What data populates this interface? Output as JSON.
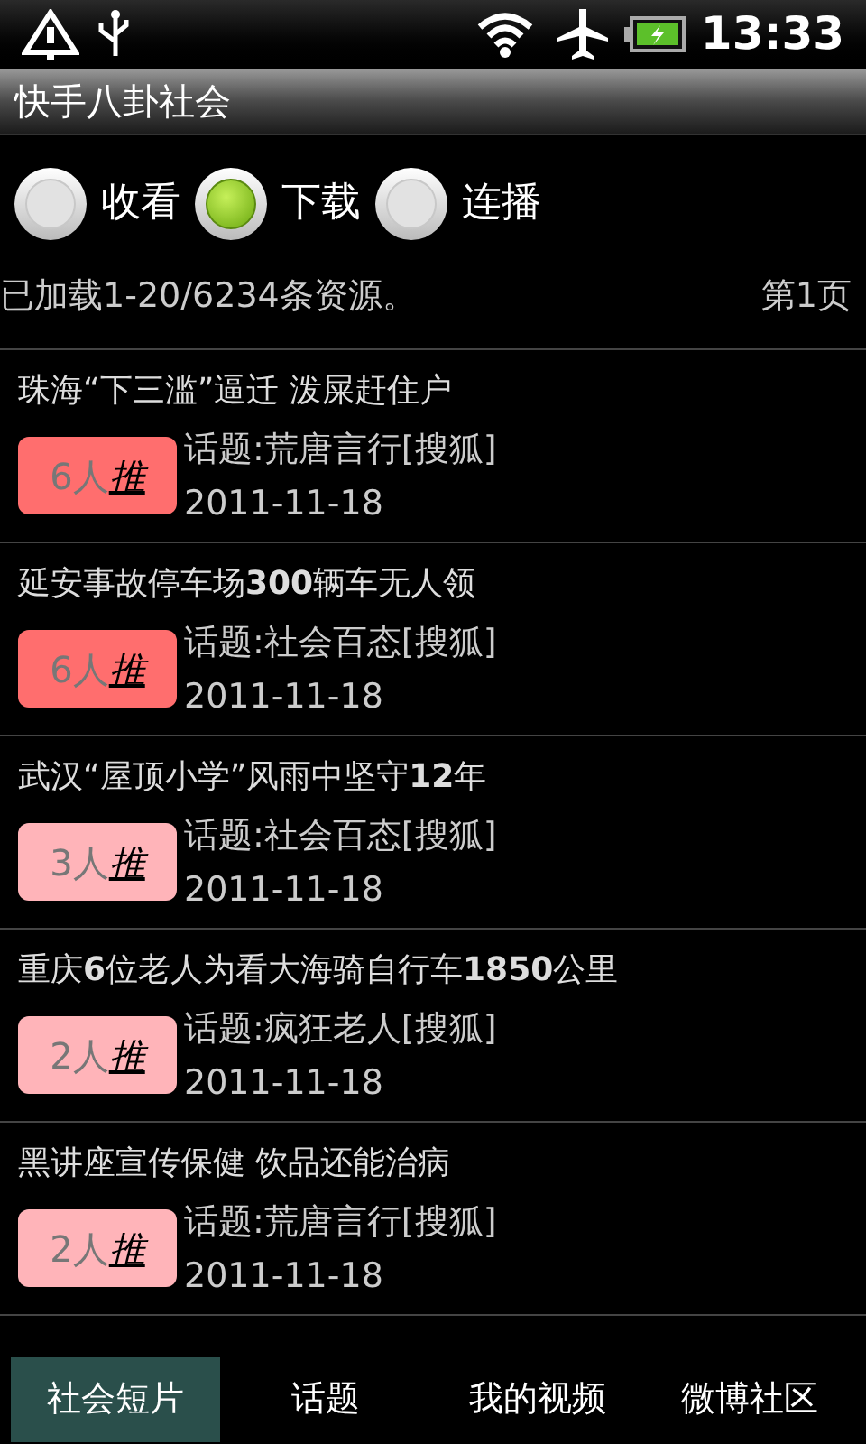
{
  "status_bar": {
    "time": "13:33"
  },
  "window": {
    "title": "快手八卦社会"
  },
  "modes": [
    {
      "label": "收看",
      "selected": false
    },
    {
      "label": "下载",
      "selected": true
    },
    {
      "label": "连播",
      "selected": false
    }
  ],
  "info": {
    "loaded": "已加载1-20/6234条资源。",
    "page": "第1页"
  },
  "items": [
    {
      "title": "珠海“下三滥”逼迁 泼屎赶住户",
      "count": "6人",
      "recommend": "推",
      "color": "#ff6e6e",
      "topic": "话题:荒唐言行[搜狐]",
      "date": "2011-11-18"
    },
    {
      "title": "延安事故停车场**300**辆车无人领",
      "count": "6人",
      "recommend": "推",
      "color": "#ff6e6e",
      "topic": "话题:社会百态[搜狐]",
      "date": "2011-11-18"
    },
    {
      "title": "武汉“屋顶小学”风雨中坚守**12**年",
      "count": "3人",
      "recommend": "推",
      "color": "#ffb4b9",
      "topic": "话题:社会百态[搜狐]",
      "date": "2011-11-18"
    },
    {
      "title": "重庆**6**位老人为看大海骑自行车**1850**公里",
      "count": "2人",
      "recommend": "推",
      "color": "#ffb4b9",
      "topic": "话题:疯狂老人[搜狐]",
      "date": "2011-11-18"
    },
    {
      "title": "黑讲座宣传保健 饮品还能治病",
      "count": "2人",
      "recommend": "推",
      "color": "#ffb4b9",
      "topic": "话题:荒唐言行[搜狐]",
      "date": "2011-11-18"
    }
  ],
  "tabs": [
    {
      "label": "社会短片",
      "selected": true
    },
    {
      "label": "话题",
      "selected": false
    },
    {
      "label": "我的视频",
      "selected": false
    },
    {
      "label": "微博社区",
      "selected": false
    }
  ]
}
